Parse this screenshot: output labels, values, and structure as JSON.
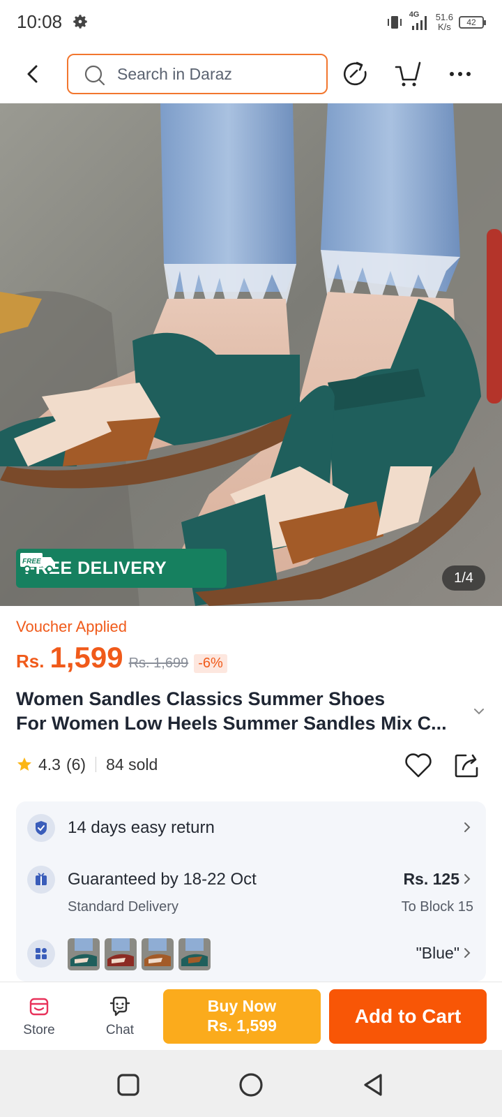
{
  "status_bar": {
    "time": "10:08",
    "net_speed_value": "51.6",
    "net_speed_unit": "K/s",
    "battery": "42",
    "network": "4G"
  },
  "header": {
    "search_placeholder": "Search in Daraz"
  },
  "gallery": {
    "free_delivery_label": "FREE DELIVERY",
    "free_delivery_icon_text": "FREE",
    "counter": "1/4"
  },
  "product": {
    "voucher_text": "Voucher Applied",
    "price_prefix": "Rs.",
    "price": "1,599",
    "old_price": "Rs. 1,699",
    "discount": "-6%",
    "title_line1": "Women Sandles Classics Summer Shoes",
    "title_line2": "For Women Low Heels Summer Sandles Mix C...",
    "rating": "4.3",
    "rating_count": "(6)",
    "sold": "84 sold"
  },
  "services": {
    "return_text": "14 days easy return",
    "delivery_text": "Guaranteed by 18-22 Oct",
    "delivery_sub": "Standard Delivery",
    "delivery_fee": "Rs. 125",
    "delivery_location": "To Block 15",
    "variant_selected": "\"Blue\""
  },
  "bottom_bar": {
    "store_label": "Store",
    "chat_label": "Chat",
    "buy_now_label": "Buy Now",
    "buy_now_price": "Rs. 1,599",
    "add_to_cart_label": "Add to Cart"
  },
  "colors": {
    "accent": "#f85606",
    "buy_now": "#fbab1c",
    "free_delivery": "#16805f",
    "sandal_teal": "#1f5f5c"
  }
}
